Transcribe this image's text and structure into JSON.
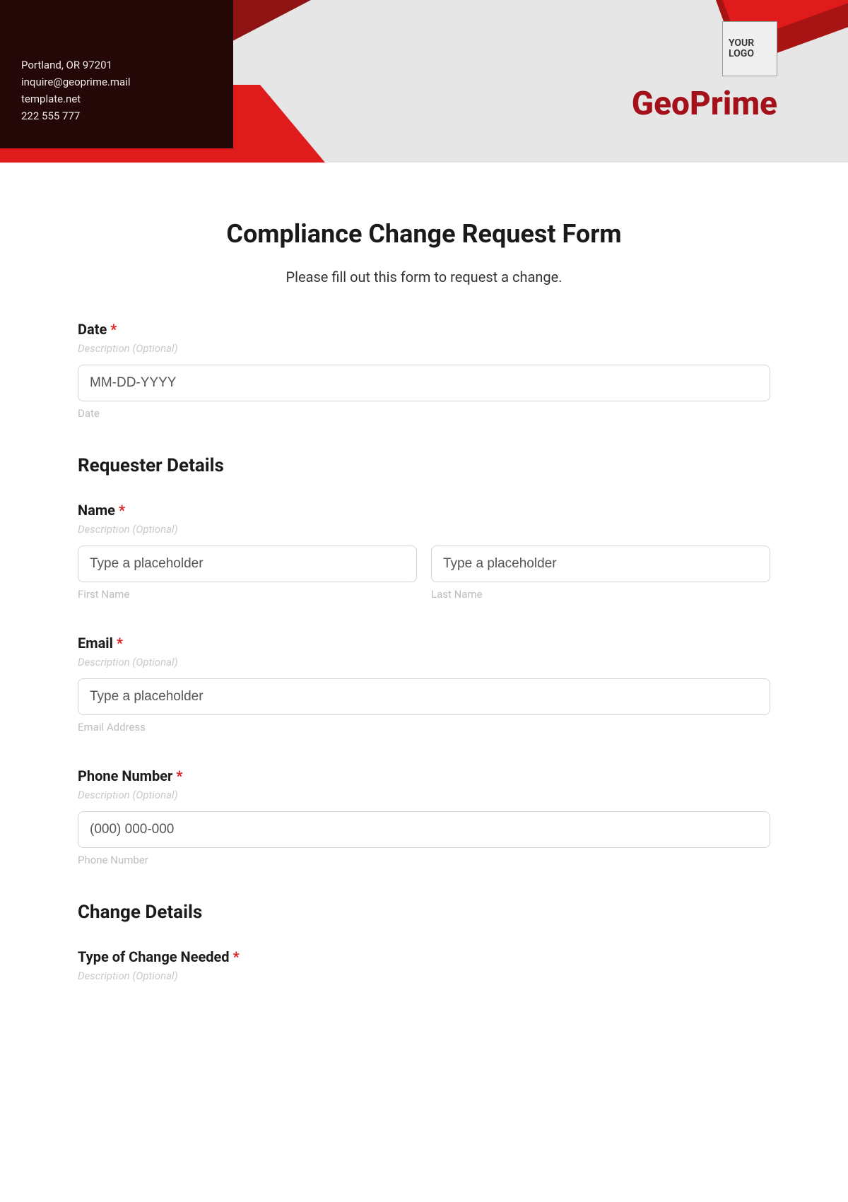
{
  "header": {
    "contact": {
      "address": "Portland, OR 97201",
      "email": "inquire@geoprime.mail",
      "site": "template.net",
      "phone": "222 555 777"
    },
    "logo_text": "YOUR LOGO",
    "brand": "GeoPrime"
  },
  "form": {
    "title": "Compliance Change Request Form",
    "subtitle": "Please fill out this form to request a change.",
    "desc_hint": "Description (Optional)"
  },
  "fields": {
    "date": {
      "label": "Date",
      "placeholder": "MM-DD-YYYY",
      "sub": "Date"
    },
    "requester_section": "Requester Details",
    "name": {
      "label": "Name",
      "first_placeholder": "Type a placeholder",
      "first_sub": "First Name",
      "last_placeholder": "Type a placeholder",
      "last_sub": "Last Name"
    },
    "email": {
      "label": "Email",
      "placeholder": "Type a placeholder",
      "sub": "Email Address"
    },
    "phone": {
      "label": "Phone Number",
      "placeholder": "(000) 000-000",
      "sub": "Phone Number"
    },
    "change_section": "Change Details",
    "change_type": {
      "label": "Type of Change Needed"
    }
  }
}
